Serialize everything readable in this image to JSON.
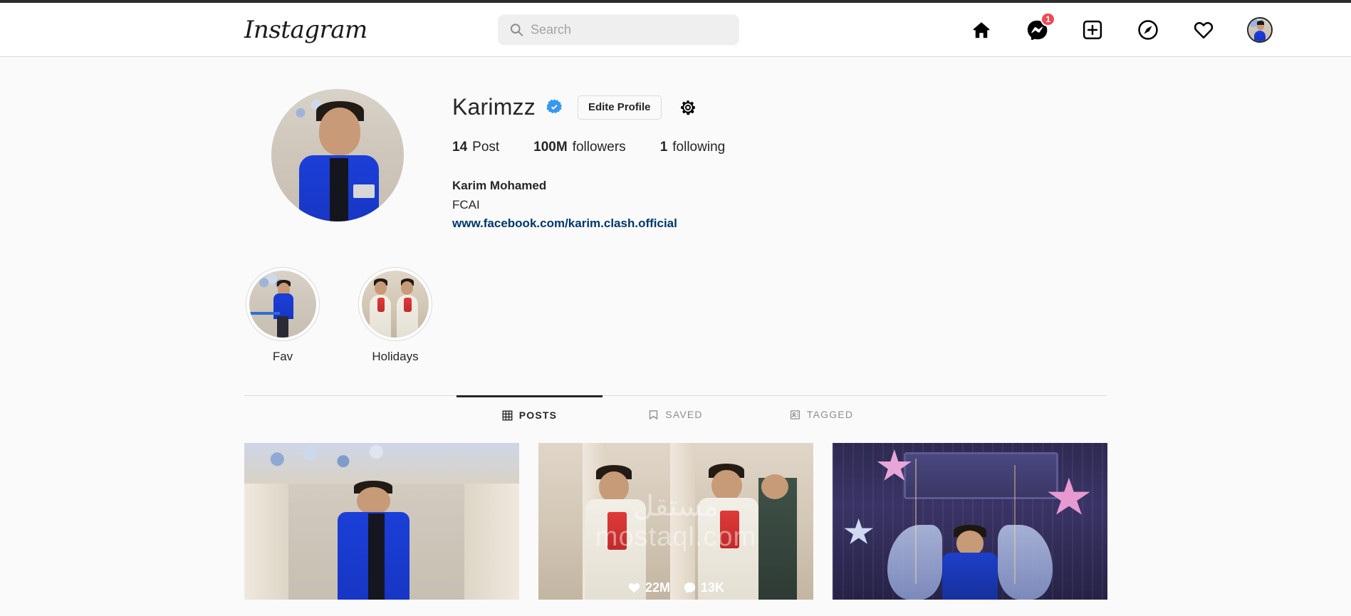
{
  "header": {
    "logo": "Instagram",
    "search": {
      "placeholder": "Search",
      "value": "",
      "icon": "search-icon"
    },
    "nav": [
      {
        "name": "home-icon",
        "label": "Home",
        "badge": null
      },
      {
        "name": "messenger-icon",
        "label": "Messages",
        "badge": "1"
      },
      {
        "name": "new-post-icon",
        "label": "New Post",
        "badge": null
      },
      {
        "name": "explore-compass-icon",
        "label": "Explore",
        "badge": null
      },
      {
        "name": "heart-activity-icon",
        "label": "Activity",
        "badge": null
      },
      {
        "name": "profile-avatar",
        "label": "Profile",
        "badge": null
      }
    ]
  },
  "profile": {
    "username": "Karimzz",
    "verified": true,
    "verified_color": "#3897f0",
    "edit_button": "Edite Profile",
    "settings_icon": "gear-icon",
    "stats": [
      {
        "value": "14",
        "label": "Post"
      },
      {
        "value": "100M",
        "label": "followers"
      },
      {
        "value": "1",
        "label": "following"
      }
    ],
    "bio": {
      "full_name": "Karim Mohamed",
      "description": "FCAI",
      "link": "www.facebook.com/karim.clash.official",
      "link_color": "#00376b"
    }
  },
  "highlights": [
    {
      "label": "Fav"
    },
    {
      "label": "Holidays"
    }
  ],
  "tabs": [
    {
      "label": "POSTS",
      "icon": "grid-icon",
      "active": true
    },
    {
      "label": "SAVED",
      "icon": "bookmark-icon",
      "active": false
    },
    {
      "label": "TAGGED",
      "icon": "tagged-icon",
      "active": false
    }
  ],
  "posts": [
    {
      "likes": null,
      "comments": null,
      "hovered": false,
      "watermark": null
    },
    {
      "likes": "22M",
      "comments": "13K",
      "hovered": true,
      "watermark": {
        "arabic": "مستقل",
        "latin": "mostaql.com"
      }
    },
    {
      "likes": null,
      "comments": null,
      "hovered": false,
      "watermark": null
    }
  ],
  "theme": {
    "background": "#fafafa",
    "header_background": "#ffffff",
    "border": "#dbdbdb",
    "text": "#262626",
    "muted_text": "#8e8e8e",
    "badge_red": "#ed4956"
  }
}
